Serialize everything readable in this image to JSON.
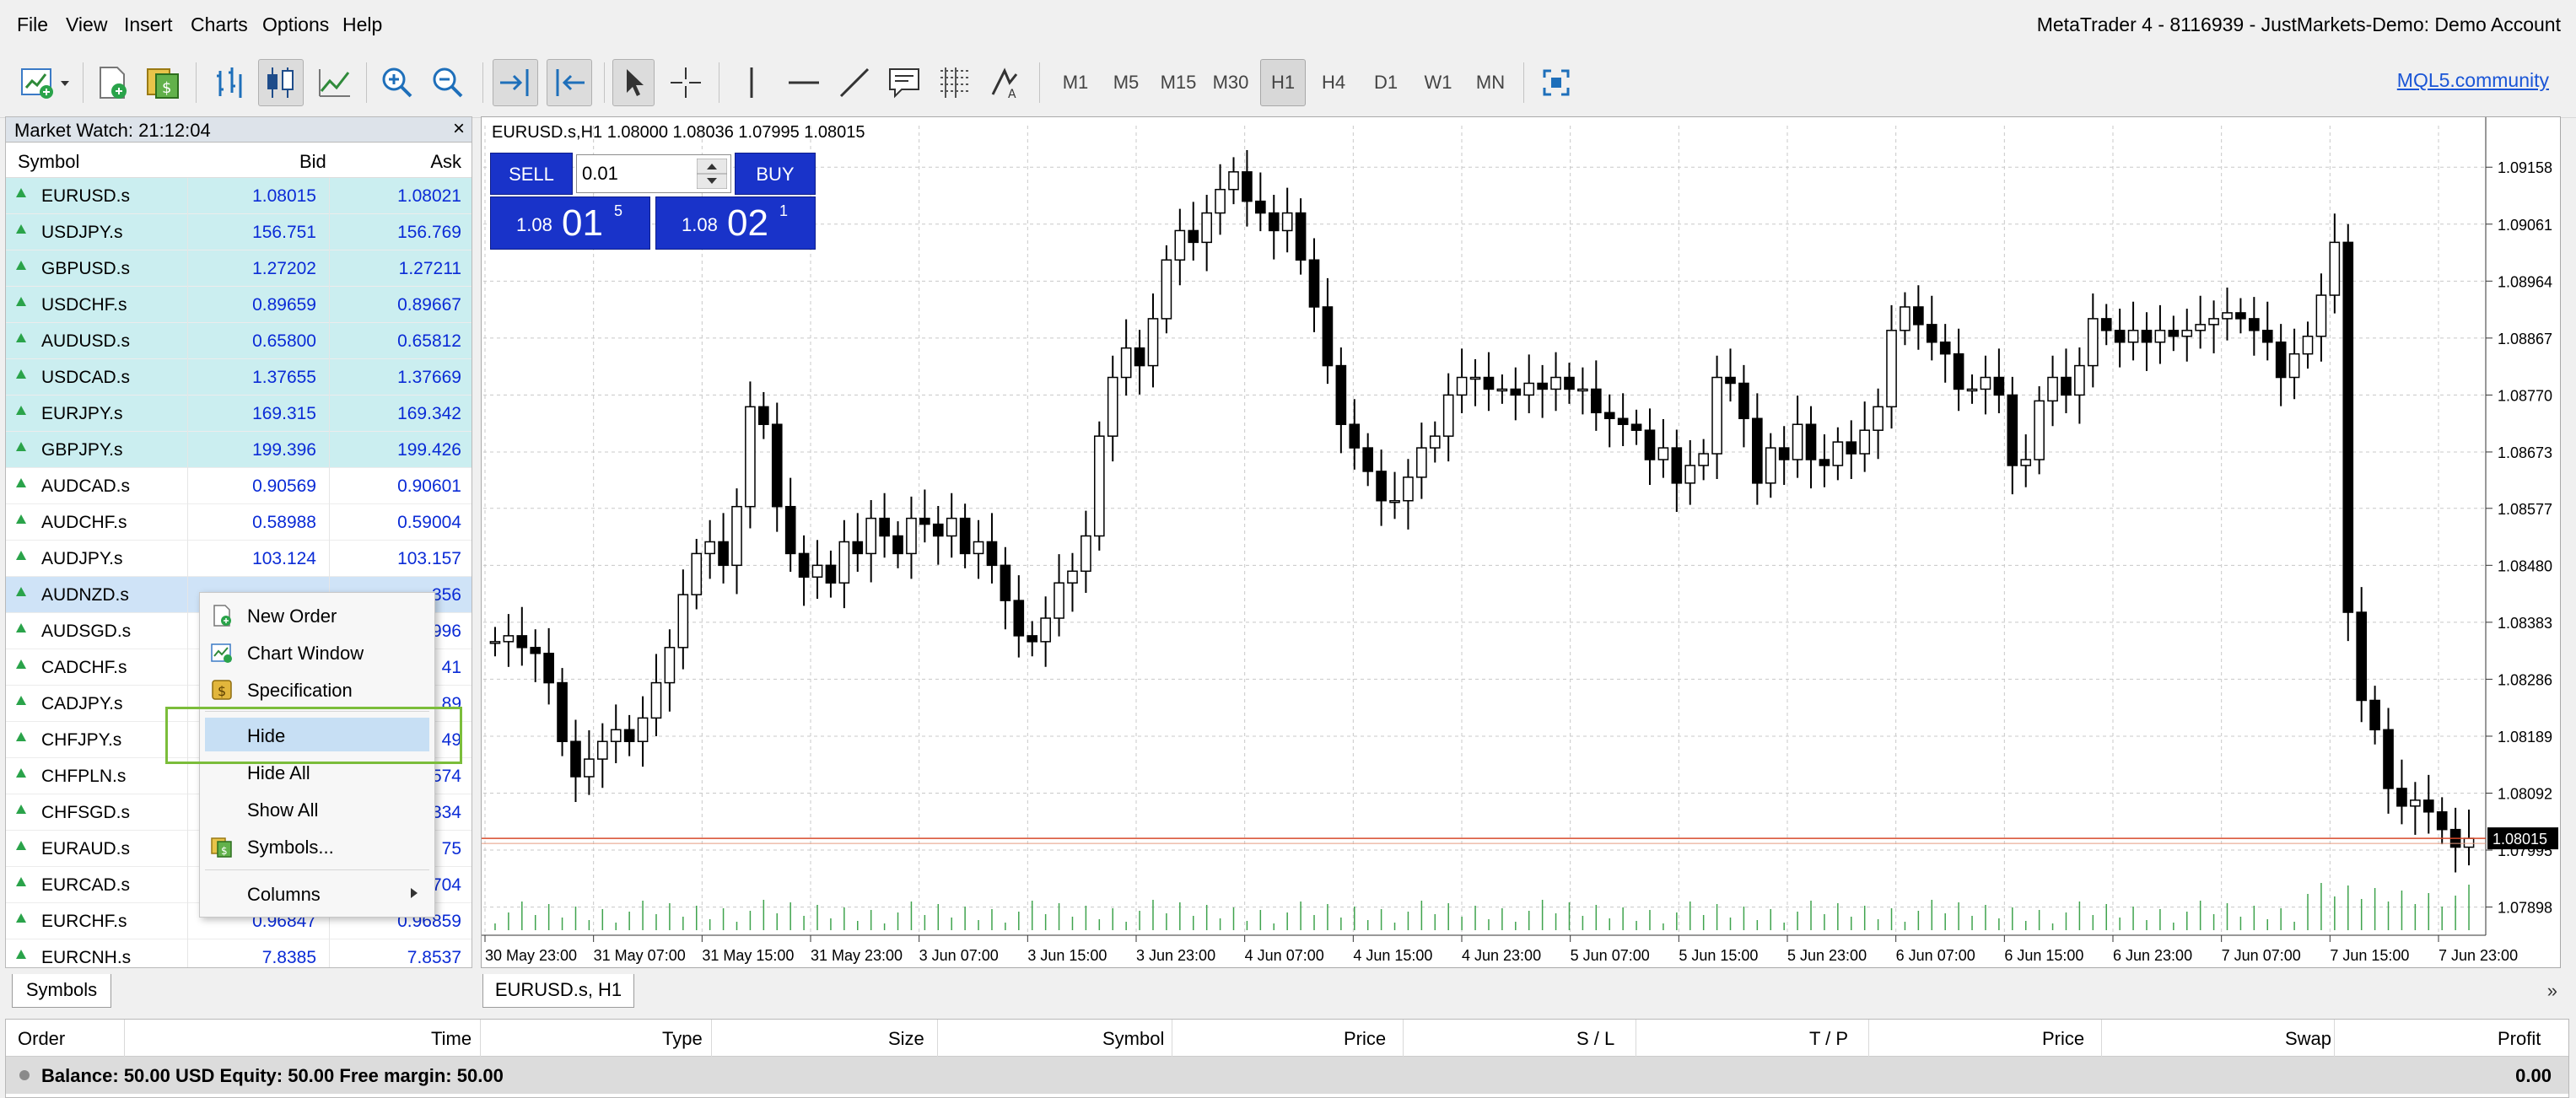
{
  "menubar": {
    "items": [
      "File",
      "View",
      "Insert",
      "Charts",
      "Options",
      "Help"
    ],
    "window_title": "MetaTrader 4 - 8116939 - JustMarkets-Demo: Demo Account"
  },
  "toolbar": {
    "timeframes": [
      "M1",
      "M5",
      "M15",
      "M30",
      "H1",
      "H4",
      "D1",
      "W1",
      "MN"
    ],
    "active_timeframe": "H1",
    "community_link": "MQL5.community"
  },
  "market_watch": {
    "title": "Market Watch: 21:12:04",
    "close_glyph": "×",
    "columns": {
      "symbol": "Symbol",
      "bid": "Bid",
      "ask": "Ask"
    },
    "rows": [
      {
        "symbol": "EURUSD.s",
        "bid": "1.08015",
        "ask": "1.08021"
      },
      {
        "symbol": "USDJPY.s",
        "bid": "156.751",
        "ask": "156.769"
      },
      {
        "symbol": "GBPUSD.s",
        "bid": "1.27202",
        "ask": "1.27211"
      },
      {
        "symbol": "USDCHF.s",
        "bid": "0.89659",
        "ask": "0.89667"
      },
      {
        "symbol": "AUDUSD.s",
        "bid": "0.65800",
        "ask": "0.65812"
      },
      {
        "symbol": "USDCAD.s",
        "bid": "1.37655",
        "ask": "1.37669"
      },
      {
        "symbol": "EURJPY.s",
        "bid": "169.315",
        "ask": "169.342"
      },
      {
        "symbol": "GBPJPY.s",
        "bid": "199.396",
        "ask": "199.426"
      },
      {
        "symbol": "AUDCAD.s",
        "bid": "0.90569",
        "ask": "0.90601"
      },
      {
        "symbol": "AUDCHF.s",
        "bid": "0.58988",
        "ask": "0.59004"
      },
      {
        "symbol": "AUDJPY.s",
        "bid": "103.124",
        "ask": "103.157"
      },
      {
        "symbol": "AUDNZD.s",
        "bid": "",
        "ask": "356"
      },
      {
        "symbol": "AUDSGD.s",
        "bid": "",
        "ask": "996"
      },
      {
        "symbol": "CADCHF.s",
        "bid": "",
        "ask": "41"
      },
      {
        "symbol": "CADJPY.s",
        "bid": "",
        "ask": "89"
      },
      {
        "symbol": "CHFJPY.s",
        "bid": "",
        "ask": "49"
      },
      {
        "symbol": "CHFPLN.s",
        "bid": "",
        "ask": "574"
      },
      {
        "symbol": "CHFSGD.s",
        "bid": "",
        "ask": "334"
      },
      {
        "symbol": "EURAUD.s",
        "bid": "",
        "ask": "75"
      },
      {
        "symbol": "EURCAD.s",
        "bid": "",
        "ask": "704"
      },
      {
        "symbol": "EURCHF.s",
        "bid": "0.96847",
        "ask": "0.96859"
      },
      {
        "symbol": "EURCNH.s",
        "bid": "7.8385",
        "ask": "7.8537"
      }
    ],
    "tab_label": "Symbols"
  },
  "context_menu": {
    "items": [
      {
        "label": "New Order",
        "icon": "new-order-icon"
      },
      {
        "label": "Chart Window",
        "icon": "chart-window-icon"
      },
      {
        "label": "Specification",
        "icon": "specification-icon"
      },
      {
        "label": "Hide",
        "icon": ""
      },
      {
        "label": "Hide All",
        "icon": ""
      },
      {
        "label": "Show All",
        "icon": ""
      },
      {
        "label": "Symbols...",
        "icon": "symbols-icon"
      },
      {
        "label": "Columns",
        "icon": ""
      }
    ],
    "highlighted": "Hide",
    "highlight_color": "#7bbd3a"
  },
  "chart": {
    "header": "EURUSD.s,H1  1.08000 1.08036 1.07995 1.08015",
    "tab_label": "EURUSD.s, H1",
    "trade_panel": {
      "sell_label": "SELL",
      "buy_label": "BUY",
      "lot_value": "0.01",
      "sell_small": "1.08",
      "sell_big": "01",
      "sell_sup": "5",
      "buy_small": "1.08",
      "buy_big": "02",
      "buy_sup": "1"
    },
    "current_price_label": "1.08015",
    "scroll_glyph": "»"
  },
  "chart_data": {
    "type": "candlestick",
    "symbol": "EURUSD.s",
    "timeframe": "H1",
    "y_ticks": [
      "1.09158",
      "1.09061",
      "1.08964",
      "1.08867",
      "1.08770",
      "1.08673",
      "1.08577",
      "1.08480",
      "1.08383",
      "1.08286",
      "1.08189",
      "1.08092",
      "1.07995",
      "1.07898"
    ],
    "ylim": [
      1.0785,
      1.092
    ],
    "x_ticks": [
      "30 May 23:00",
      "31 May 07:00",
      "31 May 15:00",
      "31 May 23:00",
      "3 Jun 07:00",
      "3 Jun 15:00",
      "3 Jun 23:00",
      "4 Jun 07:00",
      "4 Jun 15:00",
      "4 Jun 23:00",
      "5 Jun 07:00",
      "5 Jun 15:00",
      "5 Jun 23:00",
      "6 Jun 07:00",
      "6 Jun 15:00",
      "6 Jun 23:00",
      "7 Jun 07:00",
      "7 Jun 15:00",
      "7 Jun 23:00"
    ],
    "bid_line": 1.08015,
    "close_series": [
      1.0835,
      1.0836,
      1.0834,
      1.0833,
      1.0828,
      1.0818,
      1.0812,
      1.0815,
      1.0818,
      1.082,
      1.0818,
      1.0822,
      1.0828,
      1.0834,
      1.0843,
      1.085,
      1.0852,
      1.0848,
      1.0858,
      1.0875,
      1.0872,
      1.0858,
      1.085,
      1.0846,
      1.0848,
      1.0845,
      1.0852,
      1.085,
      1.0856,
      1.0853,
      1.085,
      1.0856,
      1.0855,
      1.0853,
      1.0856,
      1.085,
      1.0852,
      1.0848,
      1.0842,
      1.0836,
      1.0835,
      1.0839,
      1.0845,
      1.0847,
      1.0853,
      1.087,
      1.088,
      1.0885,
      1.0882,
      1.089,
      1.09,
      1.0905,
      1.0903,
      1.0908,
      1.0912,
      1.0915,
      1.091,
      1.0908,
      1.0905,
      1.0908,
      1.09,
      1.0892,
      1.0882,
      1.0872,
      1.0868,
      1.0864,
      1.0859,
      1.0859,
      1.0863,
      1.0868,
      1.087,
      1.0877,
      1.088,
      1.088,
      1.0878,
      1.0878,
      1.0877,
      1.0879,
      1.0878,
      1.088,
      1.0878,
      1.0878,
      1.0874,
      1.0873,
      1.0872,
      1.0871,
      1.0866,
      1.0868,
      1.0862,
      1.0865,
      1.0867,
      1.088,
      1.0879,
      1.0873,
      1.0862,
      1.0868,
      1.0866,
      1.0872,
      1.0866,
      1.0865,
      1.0869,
      1.0867,
      1.0871,
      1.0875,
      1.0888,
      1.0892,
      1.0889,
      1.0886,
      1.0884,
      1.0878,
      1.0878,
      1.088,
      1.0877,
      1.0865,
      1.0866,
      1.0876,
      1.088,
      1.0877,
      1.0882,
      1.089,
      1.0888,
      1.0886,
      1.0888,
      1.0886,
      1.0888,
      1.0887,
      1.0888,
      1.0889,
      1.089,
      1.0891,
      1.089,
      1.0888,
      1.0886,
      1.088,
      1.0884,
      1.0887,
      1.0894,
      1.0903,
      1.084,
      1.0825,
      1.082,
      1.081,
      1.0807,
      1.0808,
      1.0806,
      1.0803,
      1.08,
      1.08015
    ]
  }
}
